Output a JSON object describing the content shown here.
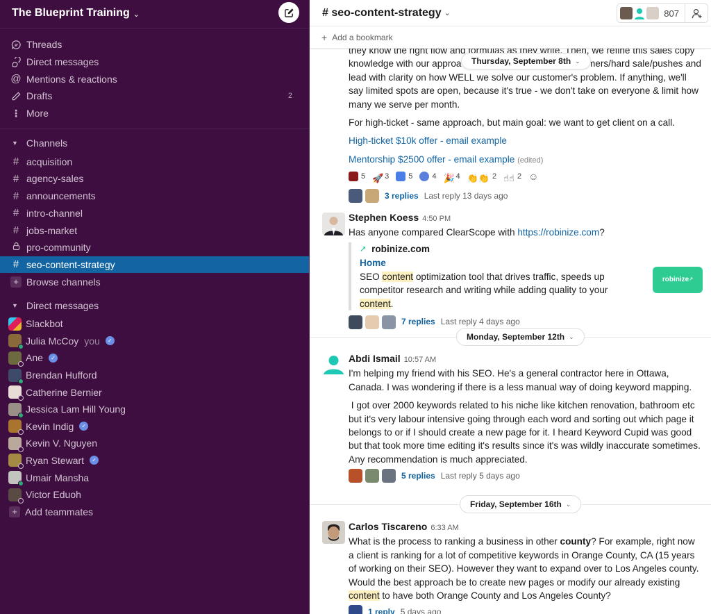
{
  "workspace": {
    "name": "The Blueprint Training"
  },
  "sidebar": {
    "nav": [
      {
        "label": "Threads",
        "icon": "threads-icon"
      },
      {
        "label": "Direct messages",
        "icon": "direct-messages-icon"
      },
      {
        "label": "Mentions & reactions",
        "icon": "at-sign-icon"
      },
      {
        "label": "Drafts",
        "icon": "pencil-icon",
        "count": "2"
      },
      {
        "label": "More",
        "icon": "more-vertical-icon"
      }
    ],
    "channels_header": "Channels",
    "channels": [
      {
        "name": "acquisition",
        "icon": "hash-icon"
      },
      {
        "name": "agency-sales",
        "icon": "hash-icon"
      },
      {
        "name": "announcements",
        "icon": "hash-icon"
      },
      {
        "name": "intro-channel",
        "icon": "hash-icon"
      },
      {
        "name": "jobs-market",
        "icon": "hash-icon"
      },
      {
        "name": "pro-community",
        "icon": "lock-icon"
      },
      {
        "name": "seo-content-strategy",
        "icon": "hash-icon",
        "active": true
      }
    ],
    "browse_channels": "Browse channels",
    "dm_header": "Direct messages",
    "dms": [
      {
        "name": "Slackbot"
      },
      {
        "name": "Julia McCoy",
        "suffix": "you",
        "verified": true,
        "presence": "online"
      },
      {
        "name": "Ane",
        "verified": true,
        "presence": "away"
      },
      {
        "name": "Brendan Hufford",
        "presence": "online"
      },
      {
        "name": "Catherine Bernier",
        "presence": "away"
      },
      {
        "name": "Jessica Lam Hill Young",
        "presence": "online"
      },
      {
        "name": "Kevin Indig",
        "verified": true,
        "presence": "away"
      },
      {
        "name": "Kevin V. Nguyen",
        "presence": "away"
      },
      {
        "name": "Ryan Stewart",
        "verified": true,
        "presence": "away"
      },
      {
        "name": "Umair Mansha",
        "presence": "online"
      },
      {
        "name": "Victor Eduoh",
        "presence": "away"
      }
    ],
    "add_teammates": "Add teammates"
  },
  "channel": {
    "title": "# seo-content-strategy",
    "member_count": "807",
    "bookmark_label": "Add a bookmark"
  },
  "messages": {
    "partial": {
      "lines": [
        "they know the right flow and formulas as they write. Then, we refine this sales copy",
        "knowledge with our approa",
        "the timers/hard sale/pushes and",
        "lead with clarity on how WELL we solve our customer's problem. If anything, we'll say limited spots are open, because it's true - we don't take on everyone & limit how many we serve per month."
      ],
      "para2": "For high-ticket - same approach, but main goal: we want to get client on a call.",
      "link1": "High-ticket $10k offer - email example",
      "link2": "Mentorship $2500 offer - email example",
      "edited": "(edited)",
      "reactions": [
        {
          "emoji": "red-square",
          "count": "5",
          "color": "#8b1a1a"
        },
        {
          "emoji": "rocket",
          "count": "3",
          "color": "#e8a23b"
        },
        {
          "emoji": "google-docs",
          "count": "5",
          "color": "#4a7ee6"
        },
        {
          "emoji": "check-badge",
          "count": "4",
          "color": "#5b7fdc"
        },
        {
          "emoji": "party-popper",
          "count": "4",
          "color": "#e6b74a"
        },
        {
          "emoji": "clap",
          "count": "2",
          "color": "#f2c35a"
        },
        {
          "emoji": "point-up",
          "count": "2",
          "color": "#f5c85a"
        }
      ],
      "thread": {
        "replies": "3 replies",
        "last": "Last reply 13 days ago"
      }
    },
    "day1": "Thursday, September 8th",
    "stephen": {
      "sender": "Stephen Koess",
      "time": "4:50 PM",
      "text_before": "Has anyone compared ClearScope with ",
      "link": "https://robinize.com",
      "text_after": "?",
      "unfurl": {
        "site": "robinize.com",
        "title": "Home",
        "desc_1": "SEO ",
        "desc_hl1": "content",
        "desc_2": " optimization tool that drives traffic, speeds up competitor research and writing while adding quality to your ",
        "desc_hl2": "content",
        "desc_3": ".",
        "thumb_label": "robinize"
      },
      "thread": {
        "replies": "7 replies",
        "last": "Last reply 4 days ago"
      }
    },
    "day2": "Monday, September 12th",
    "abdi": {
      "sender": "Abdi Ismail",
      "time": "10:57 AM",
      "para1": "I'm helping my friend with his SEO. He's a general contractor here in Ottawa, Canada. I was wondering if there is a less manual way of doing keyword mapping.",
      "para2": " I got over 2000 keywords related to his niche like kitchen renovation, bathroom etc but it's very labour intensive going through each word and sorting out which page it belongs to or if I should create a new page for it. I heard Keyword Cupid was good but that took more time editing it's results since it's was wildly inaccurate sometimes. Any recommendation is much appreciated.",
      "thread": {
        "replies": "5 replies",
        "last": "Last reply 5 days ago"
      }
    },
    "day3": "Friday, September 16th",
    "carlos": {
      "sender": "Carlos Tiscareno",
      "time": "6:33 AM",
      "t1": "What is the process to ranking a business in other ",
      "bold": "county",
      "t2": "? For example, right now a client is ranking for a lot of competitive keywords in Orange County, CA (15 years of working on their SEO). However they want to expand over to Los Angeles county. Would the best approach be to create new pages or modify our already existing ",
      "hl": "content",
      "t3": " to have both Orange County and Los Angeles County?",
      "thread": {
        "replies": "1 reply",
        "last": "5 days ago"
      }
    }
  },
  "colors": {
    "sidebar_bg": "#3f0e40",
    "active_channel": "#1264a3",
    "link": "#1264a3",
    "highlight": "#fcefc0",
    "robinize_green": "#2ecc93"
  }
}
